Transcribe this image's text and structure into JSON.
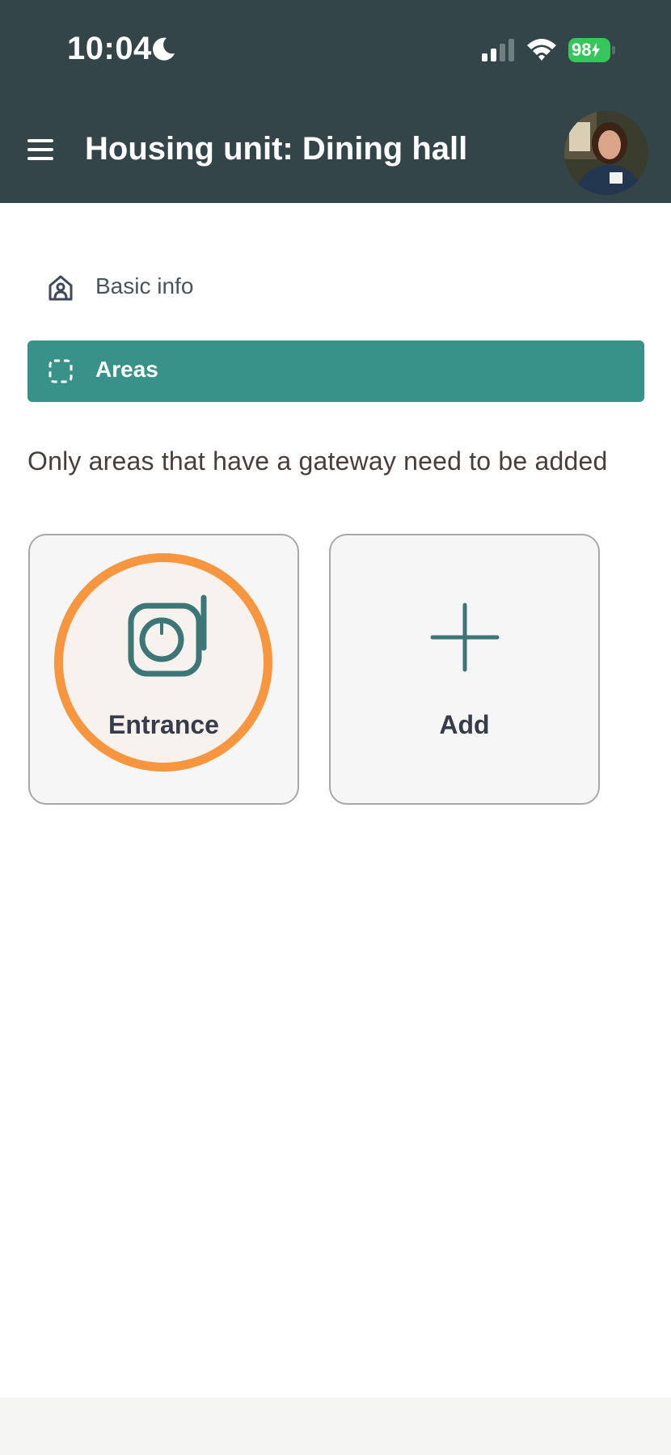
{
  "status_bar": {
    "time": "10:04",
    "battery": "98"
  },
  "header": {
    "title": "Housing unit: Dining hall"
  },
  "nav": {
    "items": [
      {
        "label": "Basic info",
        "icon": "house-user-icon",
        "active": false
      },
      {
        "label": "Areas",
        "icon": "dashed-square-icon",
        "active": true
      }
    ]
  },
  "main": {
    "hint": "Only areas that have a gateway need to be added",
    "cards": [
      {
        "label": "Entrance",
        "icon": "gateway-device-icon",
        "highlighted": true
      },
      {
        "label": "Add",
        "icon": "plus-icon"
      }
    ]
  },
  "colors": {
    "header_bg": "#334549",
    "accent": "#399289",
    "highlight_ring": "#f7963f",
    "icon_teal": "#3c7676",
    "battery": "#35c759"
  }
}
